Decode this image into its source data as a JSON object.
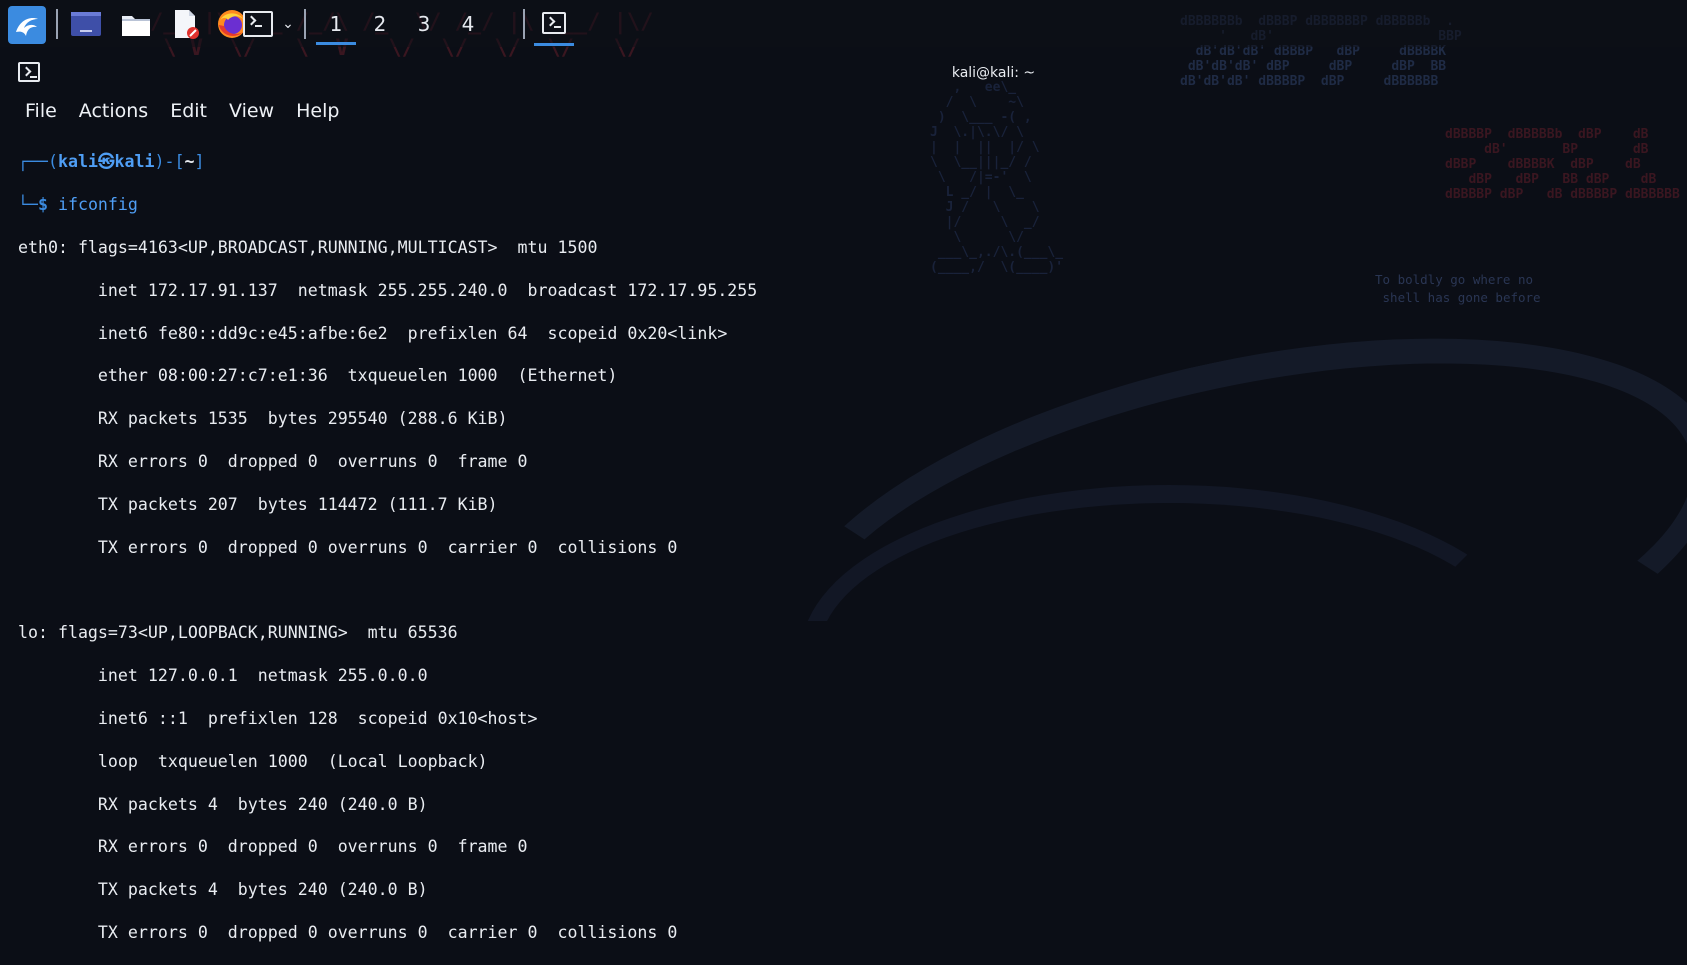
{
  "panel": {
    "menu_icon": "kali-dragon-icon",
    "launchers": [
      {
        "name": "workspace-switcher-icon"
      },
      {
        "name": "file-manager-icon"
      },
      {
        "name": "text-editor-icon"
      },
      {
        "name": "firefox-icon"
      },
      {
        "name": "terminal-icon"
      }
    ],
    "workspaces": [
      "1",
      "2",
      "3",
      "4"
    ],
    "active_workspace": "1",
    "accent_color": "#3b8be0"
  },
  "window": {
    "title": "kali@kali: ~",
    "menu": [
      "File",
      "Actions",
      "Edit",
      "View",
      "Help"
    ]
  },
  "terminal": {
    "prompt_user": "kali",
    "prompt_symbol": "㉿",
    "prompt_host": "kali",
    "prompt_dir": "~",
    "command": "ifconfig",
    "output": [
      "eth0: flags=4163<UP,BROADCAST,RUNNING,MULTICAST>  mtu 1500",
      "        inet 172.17.91.137  netmask 255.255.240.0  broadcast 172.17.95.255",
      "        inet6 fe80::dd9c:e45:afbe:6e2  prefixlen 64  scopeid 0x20<link>",
      "        ether 08:00:27:c7:e1:36  txqueuelen 1000  (Ethernet)",
      "        RX packets 1535  bytes 295540 (288.6 KiB)",
      "        RX errors 0  dropped 0  overruns 0  frame 0",
      "        TX packets 207  bytes 114472 (111.7 KiB)",
      "        TX errors 0  dropped 0 overruns 0  carrier 0  collisions 0",
      "",
      "lo: flags=73<UP,LOOPBACK,RUNNING>  mtu 65536",
      "        inet 127.0.0.1  netmask 255.0.0.0",
      "        inet6 ::1  prefixlen 128  scopeid 0x10<host>",
      "        loop  txqueuelen 1000  (Local Loopback)",
      "        RX packets 4  bytes 240 (240.0 B)",
      "        RX errors 0  dropped 0  overruns 0  frame 0",
      "        TX packets 4  bytes 240 (240.0 B)",
      "        TX errors 0  dropped 0 overruns 0  carrier 0  collisions 0"
    ]
  },
  "wallpaper": {
    "quote_line1": "To boldly go where no",
    "quote_line2": "shell has gone before"
  }
}
